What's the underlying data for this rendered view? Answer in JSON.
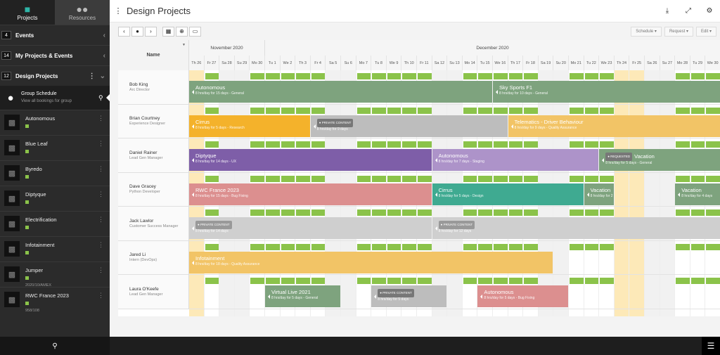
{
  "sidebar": {
    "tabs": [
      {
        "label": "Projects",
        "icon": "folder-icon",
        "active": true
      },
      {
        "label": "Resources",
        "icon": "people-icon",
        "active": false
      }
    ],
    "sections": [
      {
        "count": "4",
        "label": "Events"
      },
      {
        "count": "14",
        "label": "My Projects & Events"
      },
      {
        "count": "12",
        "label": "Design Projects"
      }
    ],
    "group": {
      "title": "Group Schedule",
      "subtitle": "View all bookings for group"
    },
    "items": [
      {
        "label": "Autonomous",
        "sub": ""
      },
      {
        "label": "Blue Leaf",
        "sub": ""
      },
      {
        "label": "Byredo",
        "sub": ""
      },
      {
        "label": "Diptyque",
        "sub": ""
      },
      {
        "label": "Electrification",
        "sub": ""
      },
      {
        "label": "Infotainment",
        "sub": ""
      },
      {
        "label": "Jumper",
        "sub": "2020/10/AMEX"
      },
      {
        "label": "RWC France 2023",
        "sub": "958/108"
      }
    ]
  },
  "header": {
    "title": "Design Projects"
  },
  "toolbar": {
    "schedule": "Schedule ▾",
    "request": "Request ▾",
    "edit": "Edit ▾"
  },
  "grid": {
    "name_header": "Name",
    "months": [
      "November 2020",
      "December 2020"
    ],
    "days": [
      "Th 26",
      "Fr 27",
      "Sa 28",
      "Su 29",
      "Mo 30",
      "Tu 1",
      "We 2",
      "Th 3",
      "Fr 4",
      "Sa 5",
      "Su 6",
      "Mo 7",
      "Tu 8",
      "We 9",
      "Th 10",
      "Fr 11",
      "Sa 12",
      "Su 13",
      "Mo 14",
      "Tu 15",
      "We 16",
      "Th 17",
      "Fr 18",
      "Sa 19",
      "Su 20",
      "Mo 21",
      "Tu 22",
      "We 23",
      "Th 24",
      "Fr 25",
      "Sa 26",
      "Su 27",
      "Mo 28",
      "Tu 29",
      "We 30"
    ],
    "rows": [
      {
        "name": "Bob King",
        "role": "Arc Director",
        "bookings": [
          {
            "start": 0,
            "days": 20,
            "title": "Autonomous",
            "detail": "8 hrs/day for 15 days - General",
            "color": "#7ea37e"
          },
          {
            "start": 20,
            "days": 15,
            "title": "Sky Sports F1",
            "detail": "8 hrs/day for 10 days - General",
            "color": "#7ea37e"
          }
        ]
      },
      {
        "name": "Brian Courtney",
        "role": "Experience Designer",
        "bookings": [
          {
            "start": 0,
            "days": 8,
            "title": "Cirrus",
            "detail": "8 hrs/day for 5 days - Research",
            "color": "#f4b22b"
          },
          {
            "start": 8,
            "days": 13,
            "title": "",
            "badge": "PRIVATE CONTENT",
            "detail": "8 hrs/day for 9 days",
            "color": "#bdbdbd"
          },
          {
            "start": 21,
            "days": 14,
            "title": "Telematics - Driver Behaviour",
            "detail": "8 hrs/day for 9 days - Quality Assurance",
            "color": "#f2c466"
          }
        ]
      },
      {
        "name": "Daniel Rainer",
        "role": "Lead Gen Manager",
        "bookings": [
          {
            "start": 0,
            "days": 16,
            "title": "Diptyque",
            "detail": "8 hrs/day for 14 days - UX",
            "color": "#7e5ea8"
          },
          {
            "start": 16,
            "days": 11,
            "title": "Autonomous",
            "detail": "8 hrs/day for 7 days - Staging",
            "color": "#ad93c9"
          },
          {
            "start": 27,
            "days": 8,
            "title": "Vacation",
            "badge": "REQUESTED",
            "detail": "8 hrs/day for 5 days - General",
            "color": "#7ea37e"
          }
        ]
      },
      {
        "name": "Dave Gracey",
        "role": "Python Developer",
        "bookings": [
          {
            "start": 0,
            "days": 16,
            "title": "RWC France 2023",
            "detail": "8 hrs/day for 15 days - Bug Fixing",
            "color": "#dc8f8f"
          },
          {
            "start": 16,
            "days": 10,
            "title": "Cirrus",
            "detail": "8 hrs/day for 5 days - Design",
            "color": "#3faa91"
          },
          {
            "start": 26,
            "days": 2,
            "title": "Vacation",
            "detail": "8 hrs/day for 2",
            "color": "#7ea37e"
          },
          {
            "start": 32,
            "days": 3,
            "title": "Vacation",
            "detail": "8 hrs/day for 4 days",
            "color": "#7ea37e"
          }
        ]
      },
      {
        "name": "Jack Lawlor",
        "role": "Customer Success Manager",
        "bookings": [
          {
            "start": 0,
            "days": 16,
            "title": "",
            "badge": "PRIVATE CONTENT",
            "detail": "8 hrs/day for 14 days",
            "color": "#cfcfcf"
          },
          {
            "start": 16,
            "days": 19,
            "title": "",
            "badge": "PRIVATE CONTENT",
            "detail": "8 hrs/day for 12 days",
            "color": "#cfcfcf"
          }
        ]
      },
      {
        "name": "Jared Li",
        "role": "Intern (DevOps)",
        "bookings": [
          {
            "start": 0,
            "days": 24,
            "title": "Infotainment",
            "detail": "8 hrs/day for 18 days - Quality Assurance",
            "color": "#f2c466"
          }
        ]
      },
      {
        "name": "Laura O'Keefe",
        "role": "Lead Gen Manager",
        "bookings": [
          {
            "start": 5,
            "days": 5,
            "title": "Virtual Live 2021",
            "detail": "8 hrs/day for 5 days - General",
            "color": "#7ea37e"
          },
          {
            "start": 12,
            "days": 5,
            "title": "",
            "badge": "PRIVATE CONTENT",
            "detail": "8 hrs/day for 5 days",
            "color": "#bdbdbd"
          },
          {
            "start": 19,
            "days": 6,
            "title": "Autonomous",
            "detail": "8 hrs/day for 5 days - Bug Fixing",
            "color": "#dc8f8f"
          }
        ]
      }
    ]
  },
  "colors": {
    "available": "#8bc34a",
    "overbooked": "#7e5ea8",
    "today": "#fde9b8"
  }
}
